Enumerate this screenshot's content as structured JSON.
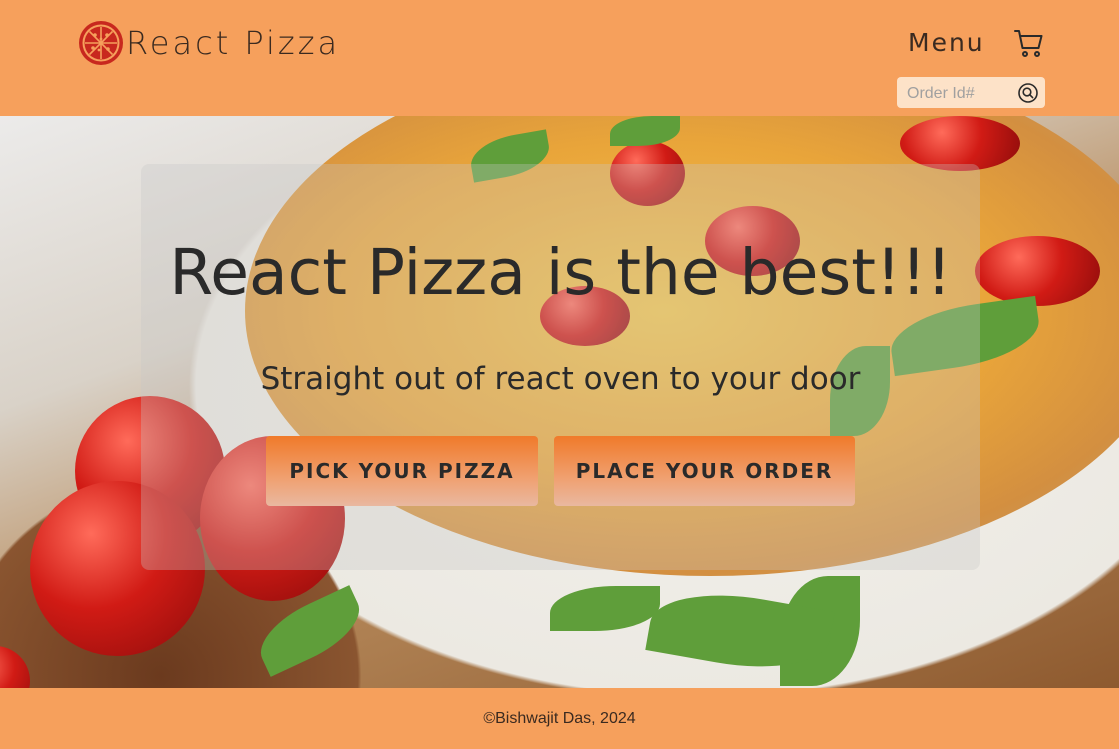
{
  "header": {
    "brand": "React Pizza",
    "menu_label": "Menu",
    "search": {
      "placeholder": "Order Id#",
      "value": ""
    }
  },
  "hero": {
    "title": "React Pizza is the best!!!",
    "subtitle": "Straight out of react oven to your door",
    "buttons": {
      "pick_label": "PICK YOUR PIZZA",
      "order_label": "PLACE YOUR ORDER"
    }
  },
  "footer": {
    "text": "©Bishwajit Das, 2024"
  },
  "colors": {
    "header_bg": "#f6a05c",
    "logo": "#c8281e",
    "button_gradient_top": "#f07a2a",
    "text_dark": "#2a2a2a"
  },
  "icons": {
    "logo": "pizza-logo-icon",
    "cart": "cart-icon",
    "search": "search-icon"
  }
}
